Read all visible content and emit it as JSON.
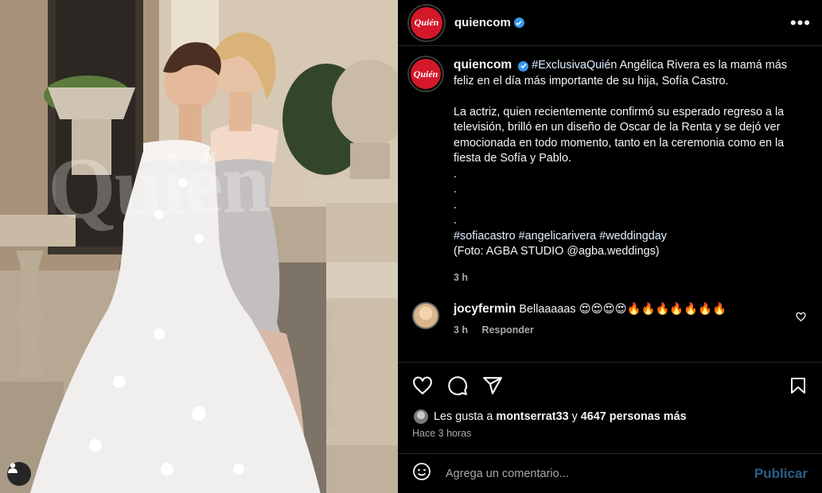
{
  "photo": {
    "watermark": "Quién"
  },
  "post": {
    "account": {
      "username": "quiencom",
      "avatar_text": "Quién",
      "verified": true,
      "brand_color": "#d3182a"
    },
    "caption": {
      "username": "quiencom",
      "hashtag_lead": "#ExclusivaQuién",
      "line1": " Angélica Rivera es la mamá más feliz en el día más importante de su hija, Sofía Castro.",
      "para2": "La actriz, quien recientemente confirmó su esperado regreso a la televisión, brilló en un diseño de Oscar de la Renta y se dejó ver emocionada en todo momento, tanto en la ceremonia como en la fiesta de Sofía y Pablo.",
      "dots": [
        ".",
        ".",
        ".",
        "."
      ],
      "hashtags": [
        "#sofiacastro",
        "#angelicarivera",
        "#weddingday"
      ],
      "credit": "(Foto: AGBA STUDIO @agba.weddings)",
      "time": "3 h"
    },
    "comment": {
      "username": "jocyfermin",
      "text": "Bellaaaaas 😍😍😍😍🔥🔥🔥🔥🔥🔥🔥",
      "time": "3 h",
      "reply_label": "Responder"
    },
    "likes": {
      "prefix": "Les gusta a ",
      "user": "montserrat33",
      "middle": " y ",
      "count": "4647 personas más"
    },
    "posted_ago": "Hace 3 horas",
    "add_comment": {
      "placeholder": "Agrega un comentario...",
      "publish_label": "Publicar"
    }
  },
  "colors": {
    "link": "#e0f1ff",
    "verified": "#3797f0",
    "publish_disabled": "#2b5f8a"
  }
}
